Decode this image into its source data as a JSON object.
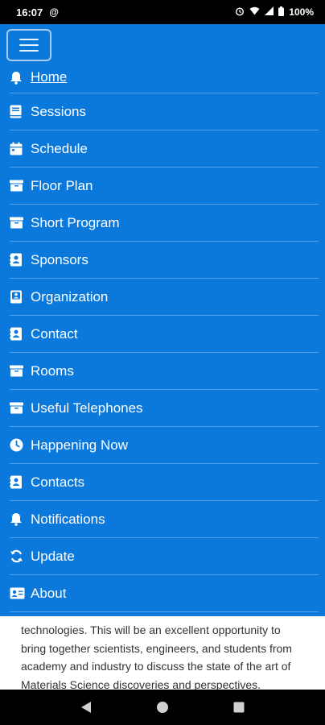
{
  "status_bar": {
    "time": "16:07",
    "battery": "100%"
  },
  "drawer": {
    "background": "#0b78dc",
    "items": [
      {
        "label": "Home",
        "icon": "bell-icon",
        "active": true
      },
      {
        "label": "Sessions",
        "icon": "book-icon"
      },
      {
        "label": "Schedule",
        "icon": "calendar-icon"
      },
      {
        "label": "Floor Plan",
        "icon": "archive-icon"
      },
      {
        "label": "Short Program",
        "icon": "archive-icon"
      },
      {
        "label": "Sponsors",
        "icon": "contact-book-icon"
      },
      {
        "label": "Organization",
        "icon": "address-book-icon"
      },
      {
        "label": "Contact",
        "icon": "contact-book-icon"
      },
      {
        "label": "Rooms",
        "icon": "archive-icon"
      },
      {
        "label": "Useful Telephones",
        "icon": "archive-icon"
      },
      {
        "label": "Happening Now",
        "icon": "clock-icon"
      },
      {
        "label": "Contacts",
        "icon": "contact-book-icon"
      },
      {
        "label": "Notifications",
        "icon": "bell-icon"
      },
      {
        "label": "Update",
        "icon": "refresh-icon"
      },
      {
        "label": "About",
        "icon": "id-card-icon"
      }
    ]
  },
  "content": {
    "text": "technologies. This will be an excellent opportunity to bring together scientists, engineers, and students from academy and industry to discuss the state of the art of Materials Science discoveries and perspectives."
  }
}
